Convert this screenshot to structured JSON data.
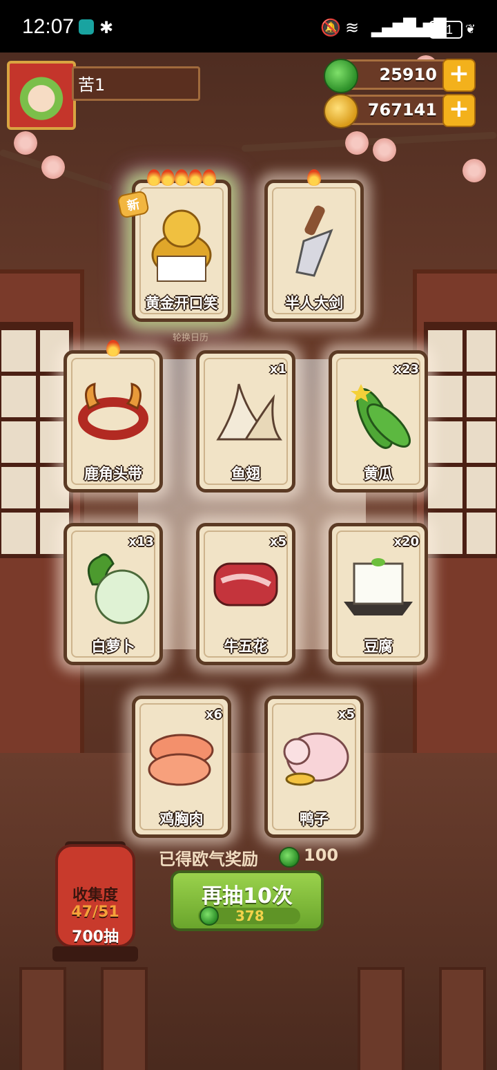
{
  "status_bar": {
    "time": "12:07",
    "battery": "91"
  },
  "player": {
    "name": "苦1"
  },
  "currencies": [
    {
      "name": "jade-coin",
      "value": "25910"
    },
    {
      "name": "gold-coin",
      "value": "767141"
    }
  ],
  "cards": [
    {
      "name": "黄金开口笑",
      "qty": "",
      "flames": 5,
      "new_label": "新",
      "rarity": "gold",
      "icon": "golden-dragon-icon"
    },
    {
      "name": "半人大剑",
      "qty": "",
      "flames": 1,
      "icon": "sword-icon"
    },
    {
      "name": "鹿角头带",
      "qty": "",
      "flames": 1,
      "icon": "antler-headband-icon"
    },
    {
      "name": "鱼翅",
      "qty": "x1",
      "flames": 0,
      "icon": "shark-fin-icon"
    },
    {
      "name": "黄瓜",
      "qty": "x23",
      "flames": 0,
      "icon": "cucumber-icon"
    },
    {
      "name": "白萝卜",
      "qty": "x13",
      "flames": 0,
      "icon": "radish-icon"
    },
    {
      "name": "牛五花",
      "qty": "x5",
      "flames": 0,
      "icon": "beef-icon"
    },
    {
      "name": "豆腐",
      "qty": "x20",
      "flames": 0,
      "icon": "tofu-icon"
    },
    {
      "name": "鸡胸肉",
      "qty": "x6",
      "flames": 0,
      "icon": "chicken-breast-icon"
    },
    {
      "name": "鸭子",
      "qty": "x5",
      "flames": 0,
      "icon": "duck-icon"
    }
  ],
  "rotation_label": "轮换日历",
  "award": {
    "label": "已得欧气奖励",
    "value": "100"
  },
  "collection": {
    "title": "收集度",
    "progress": "47/51",
    "draws": "700抽"
  },
  "draw_button": {
    "label": "再抽10次",
    "cost": "378"
  },
  "colors": {
    "jade": "#2c8f28",
    "gold": "#d99a18",
    "button_green": "#8bc744",
    "lantern_red": "#c83a2c"
  }
}
